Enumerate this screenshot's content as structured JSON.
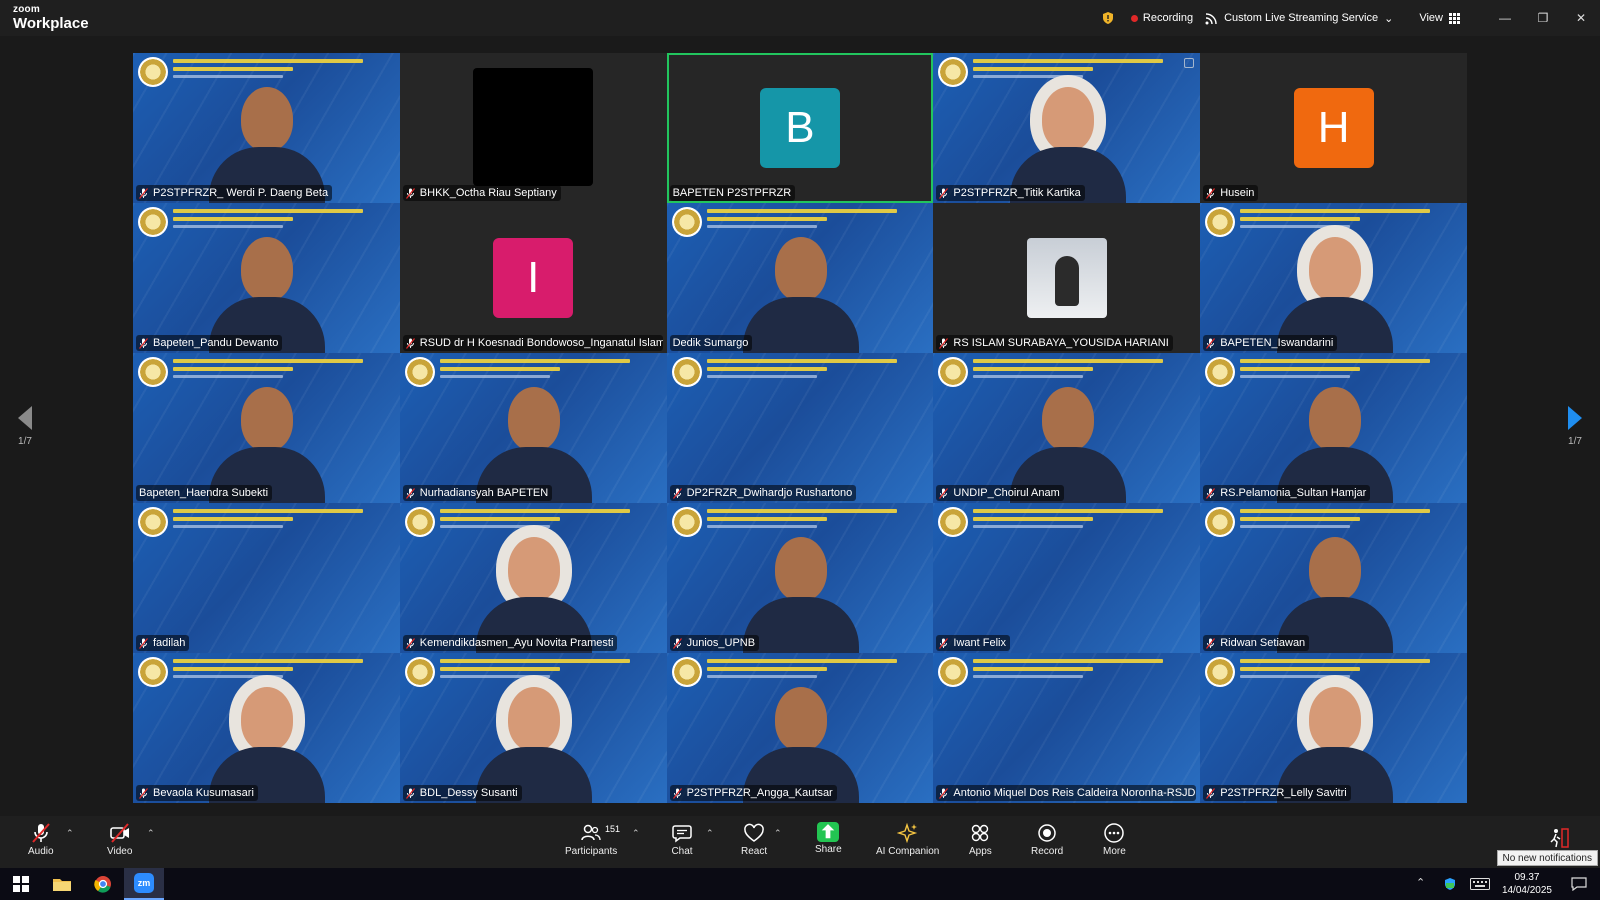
{
  "app": {
    "brand_small": "zoom",
    "brand_big": "Workplace"
  },
  "titlebar": {
    "recording_label": "Recording",
    "streaming_label": "Custom Live Streaming Service",
    "view_label": "View"
  },
  "gallery": {
    "page_left": "1/7",
    "page_right": "1/7",
    "tiles": [
      {
        "name": "P2STPFRZR_ Werdi P. Daeng Beta",
        "kind": "banner",
        "muted": true
      },
      {
        "name": "BHKK_Octha Riau Septiany",
        "kind": "black",
        "muted": true
      },
      {
        "name": "BAPETEN P2STPFRZR",
        "kind": "avatar",
        "letter": "B",
        "avatar_color": "#1596a8",
        "muted": false,
        "active": true
      },
      {
        "name": "P2STPFRZR_Titik Kartika",
        "kind": "banner-hijab",
        "muted": true
      },
      {
        "name": "Husein",
        "kind": "avatar",
        "letter": "H",
        "avatar_color": "#f0690f",
        "muted": true
      },
      {
        "name": "Bapeten_Pandu Dewanto",
        "kind": "banner",
        "muted": true
      },
      {
        "name": "RSUD dr H Koesnadi Bondowoso_Inganatul Islam...",
        "kind": "avatar",
        "letter": "I",
        "avatar_color": "#d81c6c",
        "muted": true
      },
      {
        "name": "Dedik Sumargo",
        "kind": "banner",
        "muted": false
      },
      {
        "name": "RS ISLAM SURABAYA_YOUSIDA HARIANI",
        "kind": "photo",
        "muted": true
      },
      {
        "name": "BAPETEN_Iswandarini",
        "kind": "banner-hijab",
        "muted": true
      },
      {
        "name": "Bapeten_Haendra Subekti",
        "kind": "banner",
        "muted": false
      },
      {
        "name": "Nurhadiansyah BAPETEN",
        "kind": "banner",
        "muted": true
      },
      {
        "name": "DP2FRZR_Dwihardjo Rushartono",
        "kind": "banner-empty",
        "muted": true
      },
      {
        "name": "UNDIP_Choirul Anam",
        "kind": "banner",
        "muted": true
      },
      {
        "name": "RS.Pelamonia_Sultan Hamjar",
        "kind": "banner",
        "muted": true
      },
      {
        "name": "fadilah",
        "kind": "banner-empty",
        "muted": true
      },
      {
        "name": "Kemendikdasmen_Ayu Novita Pramesti",
        "kind": "banner-hijab",
        "muted": true
      },
      {
        "name": "Junios_UPNB",
        "kind": "banner",
        "muted": true
      },
      {
        "name": "Iwant Felix",
        "kind": "banner-empty",
        "muted": true
      },
      {
        "name": "Ridwan Setiawan",
        "kind": "banner",
        "muted": true
      },
      {
        "name": "Bevaola Kusumasari",
        "kind": "banner-hijab",
        "muted": true
      },
      {
        "name": "BDL_Dessy Susanti",
        "kind": "banner-hijab",
        "muted": true
      },
      {
        "name": "P2STPFRZR_Angga_Kautsar",
        "kind": "banner",
        "muted": true
      },
      {
        "name": "Antonio Miquel Dos Reis Caldeira Noronha-RSJD...",
        "kind": "banner-empty",
        "muted": true
      },
      {
        "name": "P2STPFRZR_Lelly Savitri",
        "kind": "banner-hijab",
        "muted": true
      }
    ]
  },
  "toolbar": {
    "audio": "Audio",
    "video": "Video",
    "participants": "Participants",
    "participants_count": "151",
    "chat": "Chat",
    "react": "React",
    "share": "Share",
    "ai_companion": "AI Companion",
    "apps": "Apps",
    "record": "Record",
    "more": "More"
  },
  "notifications": {
    "toast": "No new notifications"
  },
  "taskbar": {
    "time": "09.37",
    "date": "14/04/2025"
  },
  "colors": {
    "accent_green": "#22c55e",
    "record_red": "#e02828",
    "share_green": "#23c552",
    "nav_blue": "#1f8ef0"
  }
}
